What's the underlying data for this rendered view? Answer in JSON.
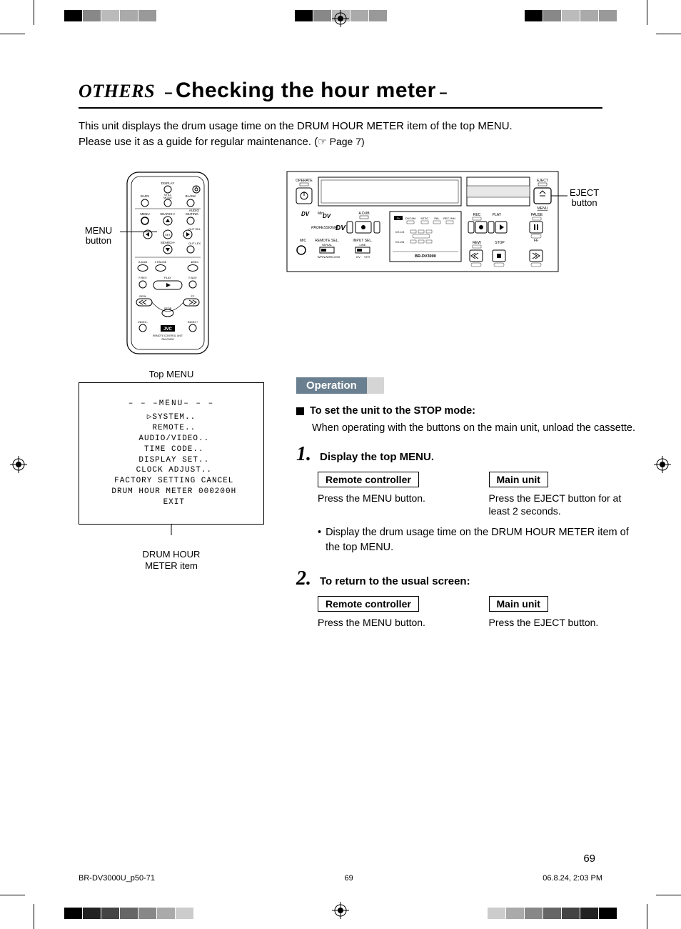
{
  "header": {
    "section": "OTHERS",
    "title": "Checking the hour meter"
  },
  "intro": {
    "line1": "This unit displays the drum usage time on the DRUM HOUR METER item of the top MENU.",
    "line2": "Please use it as a guide for regular maintenance. (",
    "pageref": "☞ Page 7)"
  },
  "labels": {
    "menu_button_l1": "MENU",
    "menu_button_l2": "button",
    "eject_button_l1": "EJECT",
    "eject_button_l2": "button",
    "top_menu": "Top MENU",
    "drum_hour_l1": "DRUM HOUR",
    "drum_hour_l2": "METER item"
  },
  "remote": {
    "top_labels": [
      "DISPLAY",
      "BARS",
      "STILL MODE",
      "BLANK",
      "AUDIO"
    ],
    "row_labels": [
      "MENU",
      "SEARCH+",
      "MUTING",
      "OUT SEL",
      "SET",
      "SEARCH-",
      "OUT LEX"
    ],
    "bottom_row1": [
      "A.DUB",
      "II PAUSE",
      "",
      "●REC"
    ],
    "bottom_row2": [
      "F.REV",
      "PLAY",
      "F.ADV"
    ],
    "bottom_row3": [
      "REW",
      "STOP",
      "FF"
    ],
    "bottom_row4": [
      "INDEX-",
      "JVC",
      "INDEX+"
    ],
    "footer1": "REMOTE CONTROL UNIT",
    "footer2": "RM-G3000"
  },
  "deck": {
    "operate": "OPERATE",
    "adub": "A.DUB",
    "professional": "PROFESSIONAL DV",
    "mic": "MIC",
    "remote_sel": "REMOTE SEL.",
    "input_sel": "INPUT SEL.",
    "serial": "SERIAL",
    "line": "LINE",
    "wpin": "WPIN",
    "wireless": "WIRELESS",
    "dv_l": "DV",
    "vtr": "VTR",
    "dvcam": "DVCAM",
    "ntsc": "NTSC",
    "pal": "PAL",
    "recinh": "REC INH.",
    "ch13": "CH-1/3",
    "ch26": "CH-2/6",
    "model": "BR-DV3000",
    "rec": "REC",
    "play": "PLAY",
    "pause": "PAUSE",
    "rew": "REW",
    "stop": "STOP",
    "ff": "FF",
    "eject": "EJECT",
    "menu": "MENU"
  },
  "menu": {
    "header": "– – –MENU– – –",
    "items": [
      "▷SYSTEM..",
      " REMOTE..",
      " AUDIO/VIDEO..",
      " TIME CODE..",
      " DISPLAY SET..",
      " CLOCK ADJUST..",
      " FACTORY SETTING CANCEL",
      " DRUM HOUR METER 000200H",
      " EXIT"
    ]
  },
  "operation": {
    "heading": "Operation",
    "stop_heading": "To set the unit to the STOP mode:",
    "stop_body": "When operating with the buttons on the main unit, unload the cassette.",
    "step1_num": "1.",
    "step1_title": "Display the top MENU.",
    "remote_label": "Remote controller",
    "main_label": "Main unit",
    "step1_remote": "Press the MENU button.",
    "step1_main": "Press the EJECT button for at least 2 seconds.",
    "step1_bullet": "Display the drum usage time on the DRUM HOUR METER item of the top MENU.",
    "step2_num": "2.",
    "step2_title": "To return to the usual screen:",
    "step2_remote": "Press the MENU button.",
    "step2_main": "Press the EJECT button."
  },
  "pageno": "69",
  "footer": {
    "left": "BR-DV3000U_p50-71",
    "center": "69",
    "right": "06.8.24, 2:03 PM"
  }
}
